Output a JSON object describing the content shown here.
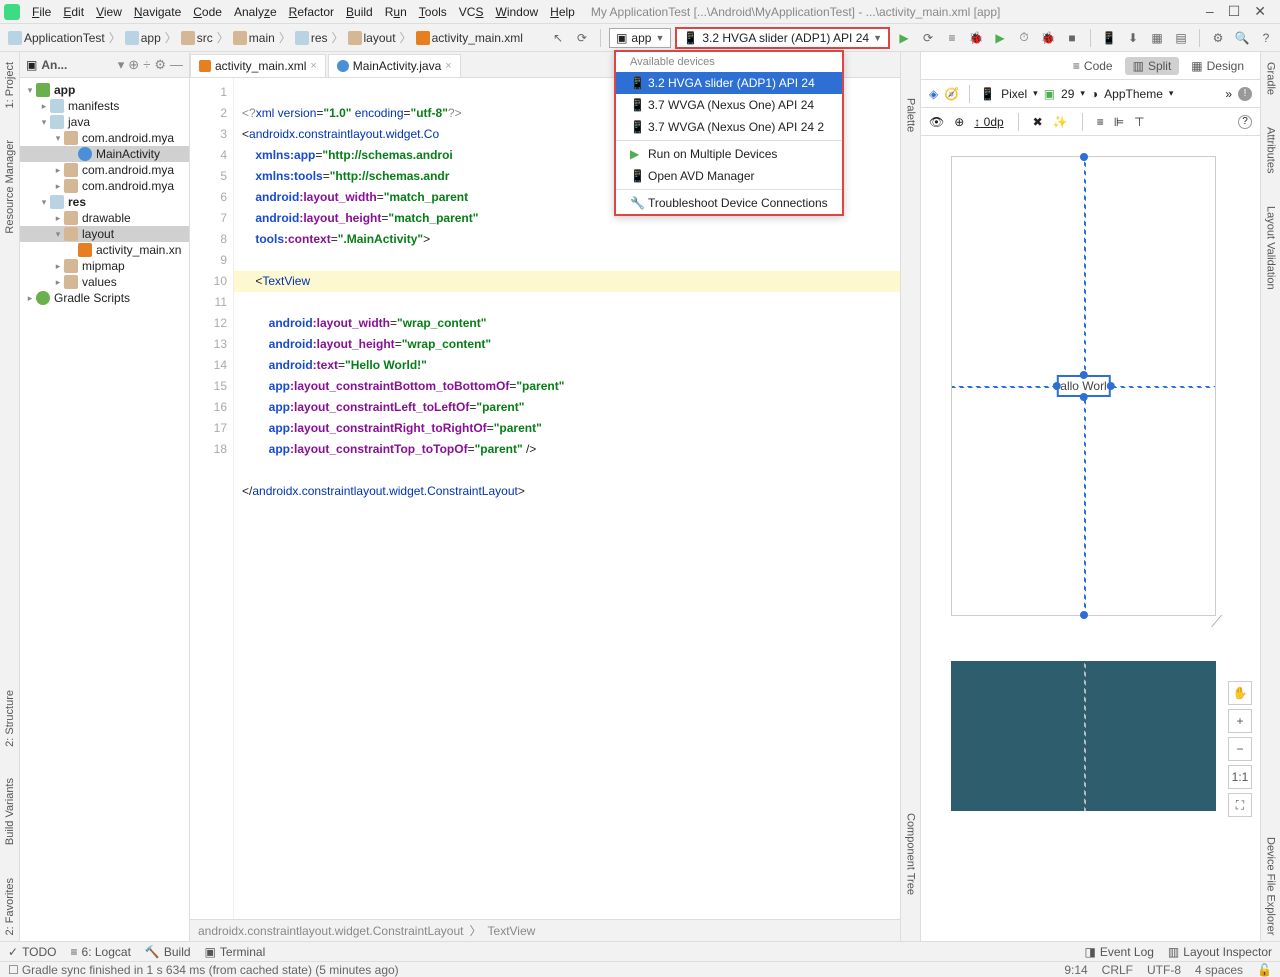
{
  "menu": {
    "items": [
      "File",
      "Edit",
      "View",
      "Navigate",
      "Code",
      "Analyze",
      "Refactor",
      "Build",
      "Run",
      "Tools",
      "VCS",
      "Window",
      "Help"
    ],
    "title": "My ApplicationTest [...\\Android\\MyApplicationTest] - ...\\activity_main.xml [app]"
  },
  "winbtns": {
    "min": "–",
    "max": "☐",
    "close": "✕"
  },
  "breadcrumbs": [
    "ApplicationTest",
    "app",
    "src",
    "main",
    "res",
    "layout",
    "activity_main.xml"
  ],
  "runconfig": {
    "module": "app",
    "device": "3.2  HVGA slider (ADP1) API 24"
  },
  "devmenu": {
    "header": "Available devices",
    "options": [
      {
        "label": "3.2  HVGA slider (ADP1) API 24",
        "sel": true,
        "icon": "📱"
      },
      {
        "label": "3.7  WVGA (Nexus One) API 24",
        "sel": false,
        "icon": "📱"
      },
      {
        "label": "3.7  WVGA (Nexus One) API 24 2",
        "sel": false,
        "icon": "📱"
      }
    ],
    "actions": [
      {
        "icon": "▶",
        "label": "Run on Multiple Devices"
      },
      {
        "icon": "📱",
        "label": "Open AVD Manager"
      },
      {
        "icon": "🔧",
        "label": "Troubleshoot Device Connections"
      }
    ]
  },
  "leftrails": [
    "1: Project",
    "Resource Manager",
    "2: Structure",
    "Build Variants",
    "2: Favorites"
  ],
  "rightrails": [
    "Gradle",
    "Attributes",
    "Layout Validation",
    "Device File Explorer"
  ],
  "sidebar": {
    "title": "An...",
    "tree": [
      {
        "d": 0,
        "tw": "▾",
        "ico": "app",
        "lbl": "app",
        "bold": true
      },
      {
        "d": 1,
        "tw": "▸",
        "ico": "folds",
        "lbl": "manifests"
      },
      {
        "d": 1,
        "tw": "▾",
        "ico": "folds",
        "lbl": "java"
      },
      {
        "d": 2,
        "tw": "▾",
        "ico": "fold",
        "lbl": "com.android.mya"
      },
      {
        "d": 3,
        "tw": "",
        "ico": "cls",
        "lbl": "MainActivity",
        "sel": true
      },
      {
        "d": 2,
        "tw": "▸",
        "ico": "fold",
        "lbl": "com.android.mya"
      },
      {
        "d": 2,
        "tw": "▸",
        "ico": "fold",
        "lbl": "com.android.mya"
      },
      {
        "d": 1,
        "tw": "▾",
        "ico": "folds",
        "lbl": "res",
        "bold": true
      },
      {
        "d": 2,
        "tw": "▸",
        "ico": "fold",
        "lbl": "drawable"
      },
      {
        "d": 2,
        "tw": "▾",
        "ico": "fold",
        "lbl": "layout",
        "sel": true
      },
      {
        "d": 3,
        "tw": "",
        "ico": "xml",
        "lbl": "activity_main.xn"
      },
      {
        "d": 2,
        "tw": "▸",
        "ico": "fold",
        "lbl": "mipmap"
      },
      {
        "d": 2,
        "tw": "▸",
        "ico": "fold",
        "lbl": "values"
      },
      {
        "d": 0,
        "tw": "▸",
        "ico": "gr",
        "lbl": "Gradle Scripts"
      }
    ]
  },
  "tabs": [
    {
      "ico": "xml",
      "label": "activity_main.xml",
      "close": true
    },
    {
      "ico": "j",
      "label": "MainActivity.java",
      "close": true
    }
  ],
  "gutter_lines": [
    "1",
    "2",
    "3",
    "4",
    "5",
    "6",
    "7",
    "8",
    "9",
    "10",
    "11",
    "12",
    "13",
    "14",
    "15",
    "16",
    "17",
    "18"
  ],
  "code": {
    "l1_a": "<?",
    "l1_b": "xml version",
    "l1_c": "=",
    "l1_d": "\"1.0\"",
    "l1_e": " encoding",
    "l1_f": "=",
    "l1_g": "\"utf-8\"",
    "l1_h": "?>",
    "l2_a": "<",
    "l2_b": "androidx.constraintlayout.widget.Co",
    "l3_a": "    ",
    "l3_b": "xmlns:",
    "l3_c": "app",
    "l3_d": "=",
    "l3_e": "\"http://schemas.androi",
    "l4_a": "    ",
    "l4_b": "xmlns:",
    "l4_c": "tools",
    "l4_d": "=",
    "l4_e": "\"http://schemas.andr",
    "l5_a": "    ",
    "l5_b": "android",
    "l5_c": ":layout_width",
    "l5_d": "=",
    "l5_e": "\"match_parent",
    "l6_a": "    ",
    "l6_b": "android",
    "l6_c": ":layout_height",
    "l6_d": "=",
    "l6_e": "\"match_parent\"",
    "l7_a": "    ",
    "l7_b": "tools",
    "l7_c": ":context",
    "l7_d": "=",
    "l7_e": "\".MainActivity\"",
    "l7_f": ">",
    "l9_a": "    <",
    "l9_b": "TextView",
    "l10_a": "        ",
    "l10_b": "android",
    "l10_c": ":layout_width",
    "l10_d": "=",
    "l10_e": "\"wrap_content\"",
    "l11_a": "        ",
    "l11_b": "android",
    "l11_c": ":layout_height",
    "l11_d": "=",
    "l11_e": "\"wrap_content\"",
    "l12_a": "        ",
    "l12_b": "android",
    "l12_c": ":text",
    "l12_d": "=",
    "l12_e": "\"Hello World!\"",
    "l13_a": "        ",
    "l13_b": "app",
    "l13_c": ":layout_constraintBottom_toBottomOf",
    "l13_d": "=",
    "l13_e": "\"parent\"",
    "l14_a": "        ",
    "l14_b": "app",
    "l14_c": ":layout_constraintLeft_toLeftOf",
    "l14_d": "=",
    "l14_e": "\"parent\"",
    "l15_a": "        ",
    "l15_b": "app",
    "l15_c": ":layout_constraintRight_toRightOf",
    "l15_d": "=",
    "l15_e": "\"parent\"",
    "l16_a": "        ",
    "l16_b": "app",
    "l16_c": ":layout_constraintTop_toTopOf",
    "l16_d": "=",
    "l16_e": "\"parent\"",
    "l16_f": " />",
    "l18_a": "</",
    "l18_b": "androidx.constraintlayout.widget.ConstraintLayout",
    "l18_c": ">"
  },
  "crumbbar": {
    "a": "androidx.constraintlayout.widget.ConstraintLayout",
    "b": "TextView"
  },
  "designtabs": {
    "code": "Code",
    "split": "Split",
    "design": "Design"
  },
  "toolbar2": {
    "pixel": "Pixel",
    "api": "29",
    "theme": "AppTheme"
  },
  "toolbar3": {
    "dp": "0dp"
  },
  "preview": {
    "tv": "allo Worl"
  },
  "zoom": {
    "plus": "+",
    "minus": "−",
    "fit": "1:1",
    "pan": "⛶",
    "hand": "✋"
  },
  "palette": {
    "p": "Palette",
    "c": "Component Tree"
  },
  "botbar": {
    "todo": "TODO",
    "logcat": "6: Logcat",
    "build": "Build",
    "terminal": "Terminal",
    "event": "Event Log",
    "layout": "Layout Inspector"
  },
  "status": {
    "msg": "Gradle sync finished in 1 s 634 ms (from cached state) (5 minutes ago)",
    "pos": "9:14",
    "crlf": "CRLF",
    "enc": "UTF-8",
    "indent": "4 spaces"
  }
}
